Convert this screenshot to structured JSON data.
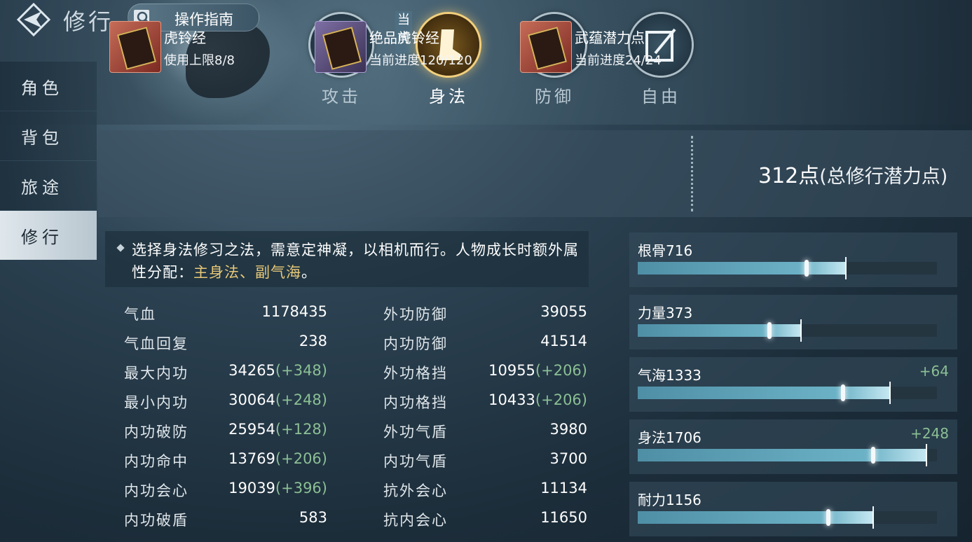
{
  "header": {
    "title": "修行",
    "guide_label": "操作指南"
  },
  "sidebar": {
    "items": [
      {
        "label": "角色"
      },
      {
        "label": "背包"
      },
      {
        "label": "旅途"
      },
      {
        "label": "修行",
        "active": true
      }
    ]
  },
  "tabs": {
    "current_badge": "当前",
    "items": [
      {
        "label": "攻击",
        "icon": "sword-icon"
      },
      {
        "label": "身法",
        "icon": "boot-icon",
        "active": true
      },
      {
        "label": "防御",
        "icon": "shield-icon"
      },
      {
        "label": "自由",
        "icon": "quill-book-icon"
      }
    ]
  },
  "items": [
    {
      "name": "虎铃经",
      "sub": "使用上限8/8",
      "rarity_color": "#c66c58"
    },
    {
      "name": "绝品虎铃经",
      "sub": "当前进度120/120",
      "rarity_color": "#7d6fa3"
    },
    {
      "name": "武蕴潜力点",
      "sub": "当前进度24/24",
      "rarity_color": "#c66c58"
    }
  ],
  "total_points": {
    "value": "312点",
    "label": "(总修行潜力点)"
  },
  "description": {
    "text": "选择身法修习之法，需意定神凝，以相机而行。人物成长时额外属性分配：",
    "highlight": "主身法、副气海",
    "end": "。"
  },
  "stats_left": [
    {
      "label": "气血",
      "value": "1178435",
      "bonus": ""
    },
    {
      "label": "气血回复",
      "value": "238",
      "bonus": ""
    },
    {
      "label": "最大内功",
      "value": "34265",
      "bonus": "(+348)"
    },
    {
      "label": "最小内功",
      "value": "30064",
      "bonus": "(+248)"
    },
    {
      "label": "内功破防",
      "value": "25954",
      "bonus": "(+128)"
    },
    {
      "label": "内功命中",
      "value": "13769",
      "bonus": "(+206)"
    },
    {
      "label": "内功会心",
      "value": "19039",
      "bonus": "(+396)"
    },
    {
      "label": "内功破盾",
      "value": "583",
      "bonus": ""
    }
  ],
  "stats_right": [
    {
      "label": "外功防御",
      "value": "39055",
      "bonus": ""
    },
    {
      "label": "内功防御",
      "value": "41514",
      "bonus": ""
    },
    {
      "label": "外功格挡",
      "value": "10955",
      "bonus": "(+206)"
    },
    {
      "label": "内功格挡",
      "value": "10433",
      "bonus": "(+206)"
    },
    {
      "label": "外功气盾",
      "value": "3980",
      "bonus": ""
    },
    {
      "label": "内功气盾",
      "value": "3700",
      "bonus": ""
    },
    {
      "label": "抗外会心",
      "value": "11134",
      "bonus": ""
    },
    {
      "label": "抗内会心",
      "value": "11650",
      "bonus": ""
    }
  ],
  "attributes": [
    {
      "name": "根骨716",
      "bonus": "",
      "fill": 0.695,
      "marker": 0.565
    },
    {
      "name": "力量373",
      "bonus": "",
      "fill": 0.545,
      "marker": 0.44
    },
    {
      "name": "气海1333",
      "bonus": "+64",
      "fill": 0.843,
      "marker": 0.687
    },
    {
      "name": "身法1706",
      "bonus": "+248",
      "fill": 0.965,
      "marker": 0.786
    },
    {
      "name": "耐力1156",
      "bonus": "",
      "fill": 0.787,
      "marker": 0.637
    }
  ],
  "colors": {
    "accent_gold": "#e8c878",
    "bonus_green": "#8bbf94",
    "bar_blue": "#6cb2c6"
  }
}
